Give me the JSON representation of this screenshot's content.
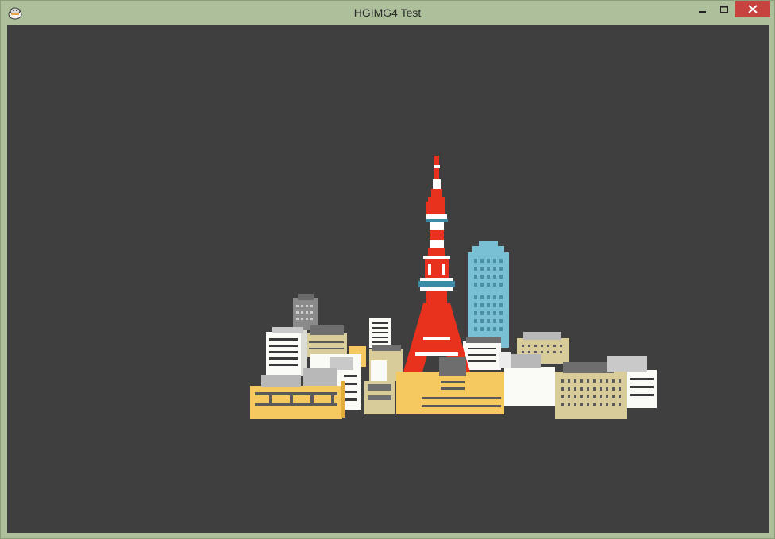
{
  "window": {
    "title": "HGIMG4 Test",
    "icons": {
      "app": "hsp-app-icon",
      "minimize": "minimize-icon",
      "maximize": "maximize-icon",
      "close": "close-icon"
    },
    "colors": {
      "frame": "#adc09b",
      "viewport": "#3f3f3f",
      "close_button": "#c7433f"
    }
  },
  "scene": {
    "description_icon": "tokyo-tower-city-scene",
    "colors": {
      "tower_red": "#e8321e",
      "tower_white": "#ffffff",
      "tower_band": "#3c8aa6",
      "glass_tower": "#79c0d4",
      "yellow_building": "#f5c860",
      "beige_building": "#d8cc9a",
      "white_building": "#fafaf6",
      "gray_roof": "#6e6e6e"
    }
  }
}
